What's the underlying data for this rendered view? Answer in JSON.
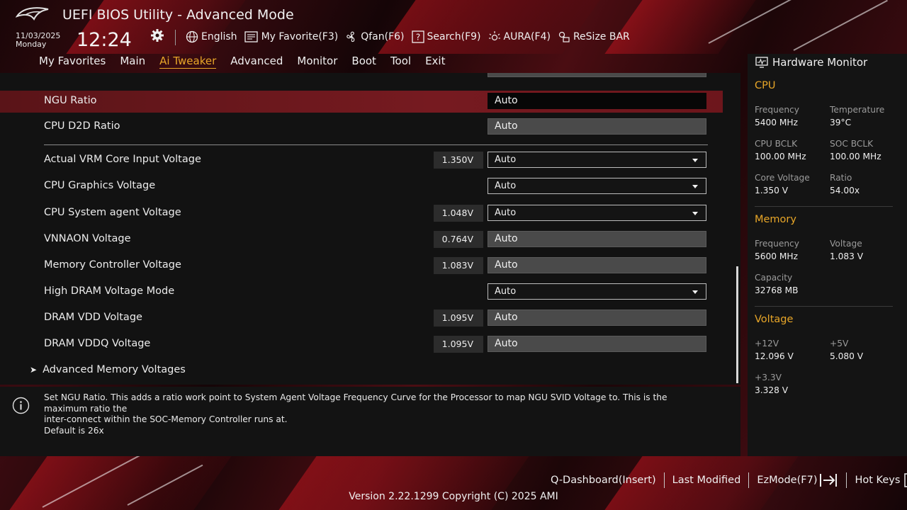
{
  "header": {
    "title": "UEFI BIOS Utility - Advanced Mode",
    "date": "11/03/2025",
    "day": "Monday",
    "time": "12:24",
    "tools": [
      {
        "icon": "globe-icon",
        "label": "English"
      },
      {
        "icon": "favorite-list-icon",
        "label": "My Favorite(F3)"
      },
      {
        "icon": "fan-icon",
        "label": "Qfan(F6)"
      },
      {
        "icon": "search-question-icon",
        "label": "Search(F9)"
      },
      {
        "icon": "aura-icon",
        "label": "AURA(F4)"
      },
      {
        "icon": "resize-bar-icon",
        "label": "ReSize BAR"
      }
    ]
  },
  "tabs": [
    {
      "label": "My Favorites",
      "active": false
    },
    {
      "label": "Main",
      "active": false
    },
    {
      "label": "Ai Tweaker",
      "active": true
    },
    {
      "label": "Advanced",
      "active": false
    },
    {
      "label": "Monitor",
      "active": false
    },
    {
      "label": "Boot",
      "active": false
    },
    {
      "label": "Tool",
      "active": false
    },
    {
      "label": "Exit",
      "active": false
    }
  ],
  "settings": [
    {
      "label": "NGU Ratio",
      "value": "Auto"
    },
    {
      "label": "CPU D2D Ratio",
      "value": "Auto"
    },
    {
      "label": "Actual VRM Core Input Voltage",
      "reading": "1.350V",
      "value": "Auto"
    },
    {
      "label": "CPU Graphics Voltage",
      "value": "Auto"
    },
    {
      "label": "CPU System agent Voltage",
      "reading": "1.048V",
      "value": "Auto"
    },
    {
      "label": "VNNAON Voltage",
      "reading": "0.764V",
      "value": "Auto"
    },
    {
      "label": "Memory Controller Voltage",
      "reading": "1.083V",
      "value": "Auto"
    },
    {
      "label": "High DRAM Voltage Mode",
      "value": "Auto"
    },
    {
      "label": "DRAM VDD Voltage",
      "reading": "1.095V",
      "value": "Auto"
    },
    {
      "label": "DRAM VDDQ Voltage",
      "reading": "1.095V",
      "value": "Auto"
    }
  ],
  "submenu": {
    "label": "Advanced Memory Voltages"
  },
  "help": {
    "line1": "Set NGU Ratio. This adds a ratio work point to System Agent Voltage Frequency Curve for the Processor to map NGU SVID Voltage to. This is the maximum ratio the",
    "line2": "inter-connect within the SOC-Memory Controller runs at.",
    "line3": "Default is 26x"
  },
  "hw_monitor": {
    "title": "Hardware Monitor",
    "cpu": {
      "heading": "CPU",
      "frequency_label": "Frequency",
      "frequency": "5400 MHz",
      "temperature_label": "Temperature",
      "temperature": "39°C",
      "cpu_bclk_label": "CPU BCLK",
      "cpu_bclk": "100.00 MHz",
      "soc_bclk_label": "SOC BCLK",
      "soc_bclk": "100.00 MHz",
      "core_voltage_label": "Core Voltage",
      "core_voltage": "1.350 V",
      "ratio_label": "Ratio",
      "ratio": "54.00x"
    },
    "memory": {
      "heading": "Memory",
      "frequency_label": "Frequency",
      "frequency": "5600 MHz",
      "voltage_label": "Voltage",
      "voltage": "1.083 V",
      "capacity_label": "Capacity",
      "capacity": "32768 MB"
    },
    "voltage": {
      "heading": "Voltage",
      "v12_label": "+12V",
      "v12": "12.096 V",
      "v5_label": "+5V",
      "v5": "5.080 V",
      "v33_label": "+3.3V",
      "v33": "3.328 V"
    }
  },
  "footer": {
    "q_dashboard": "Q-Dashboard(Insert)",
    "last_modified": "Last Modified",
    "ezmode": "EzMode(F7)",
    "hot_keys": "Hot Keys",
    "version": "Version 2.22.1299 Copyright (C) 2025 AMI"
  },
  "colors": {
    "accent": "#e8a628",
    "selected_row": "#761a20",
    "panel": "#121212"
  }
}
